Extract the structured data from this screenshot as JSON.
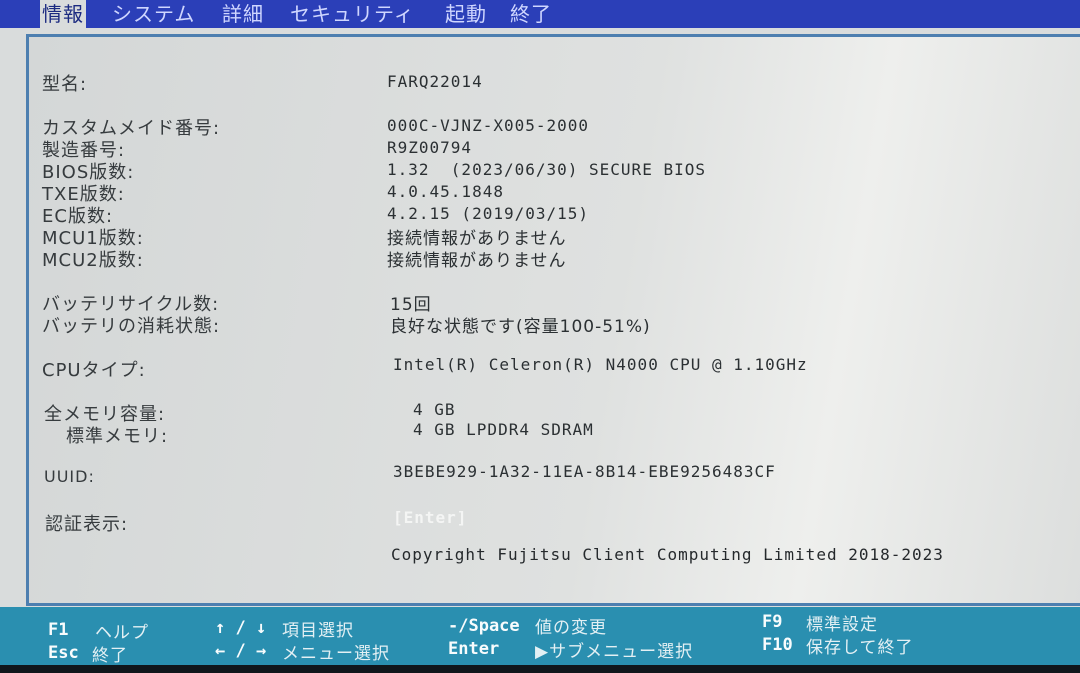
{
  "menu": {
    "tabs": [
      "情報",
      "システム",
      "詳細",
      "セキュリティ",
      "起動",
      "終了"
    ],
    "active": "情報"
  },
  "info": {
    "model_label": "型名:",
    "model_value": "FARQ22014",
    "custom_label": "カスタムメイド番号:",
    "custom_value": "000C-VJNZ-X005-2000",
    "serial_label": "製造番号:",
    "serial_value": "R9Z00794",
    "bios_label": "BIOS版数:",
    "bios_value": "1.32  (2023/06/30) SECURE BIOS",
    "txe_label": "TXE版数:",
    "txe_value": "4.0.45.1848",
    "ec_label": "EC版数:",
    "ec_value": "4.2.15 (2019/03/15)",
    "mcu1_label": "MCU1版数:",
    "mcu1_value": "接続情報がありません",
    "mcu2_label": "MCU2版数:",
    "mcu2_value": "接続情報がありません",
    "battery_cycle_label": "バッテリサイクル数:",
    "battery_cycle_value": "15回",
    "battery_wear_label": "バッテリの消耗状態:",
    "battery_wear_value": "良好な状態です(容量100-51%)",
    "cpu_label": "CPUタイプ:",
    "cpu_value": "Intel(R) Celeron(R) N4000 CPU @ 1.10GHz",
    "mem_total_label": "全メモリ容量:",
    "mem_total_value": "4 GB",
    "mem_std_label": "標準メモリ:",
    "mem_std_value": "4 GB LPDDR4 SDRAM",
    "uuid_label": "UUID:",
    "uuid_value": "3BEBE929-1A32-11EA-8B14-EBE9256483CF",
    "cert_label": "認証表示:",
    "cert_value": "[Enter]",
    "copyright": "Copyright Fujitsu Client Computing Limited 2018-2023"
  },
  "footer": {
    "f1_key": "F1",
    "f1_desc": "ヘルプ",
    "esc_key": "Esc",
    "esc_desc": "終了",
    "updown_key": "↑ / ↓",
    "updown_desc": "項目選択",
    "leftright_key": "← / →",
    "leftright_desc": "メニュー選択",
    "space_key": "-/Space",
    "space_desc": "値の変更",
    "enter_key": "Enter",
    "enter_desc": "▶サブメニュー選択",
    "f9_key": "F9",
    "f9_desc": "標準設定",
    "f10_key": "F10",
    "f10_desc": "保存して終了"
  },
  "colors": {
    "menu_bg": "#2b3fb8",
    "footer_bg": "#2a8fb0",
    "panel_border": "#4d7fb0"
  }
}
